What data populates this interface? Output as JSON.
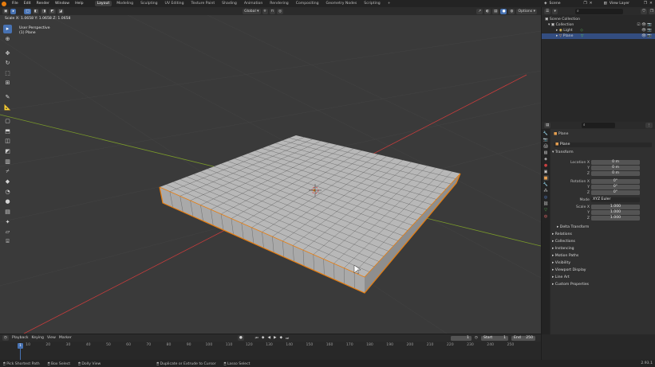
{
  "menubar": {
    "menus": [
      "File",
      "Edit",
      "Render",
      "Window",
      "Help"
    ],
    "workspaces": [
      "Layout",
      "Modeling",
      "Sculpting",
      "UV Editing",
      "Texture Paint",
      "Shading",
      "Animation",
      "Rendering",
      "Compositing",
      "Geometry Nodes",
      "Scripting"
    ],
    "active_workspace": "Layout",
    "add_tab": "+",
    "scene_label": "Scene",
    "view_layer_label": "View Layer"
  },
  "viewport": {
    "orientation_label": "Global",
    "options_label": "Options",
    "operator_info": "Scale X: 1.0658   Y: 1.0658   Z: 1.0658",
    "view_name": "User Perspective",
    "object_name": "(1) Plane"
  },
  "outliner": {
    "root": "Scene Collection",
    "items": [
      "Collection",
      "Light",
      "Plane"
    ]
  },
  "properties": {
    "search_placeholder": "",
    "object_header": "Plane",
    "object_name_field": "Plane",
    "transform_label": "Transform",
    "location_label": "Location X",
    "location": [
      "0 m",
      "0 m",
      "0 m"
    ],
    "rotation_label": "Rotation X",
    "rotation": [
      "0°",
      "0°",
      "0°"
    ],
    "mode_label": "Mode",
    "mode_value": "XYZ Euler",
    "scale_label": "Scale X",
    "scale": [
      "1.000",
      "1.000",
      "1.000"
    ],
    "axis_y": "Y",
    "axis_z": "Z",
    "sections": [
      "Delta Transform",
      "Relations",
      "Collections",
      "Instancing",
      "Motion Paths",
      "Visibility",
      "Viewport Display",
      "Line Art",
      "Custom Properties"
    ]
  },
  "timeline": {
    "menus": [
      "Playback",
      "Keying",
      "View",
      "Marker"
    ],
    "current_frame": "1",
    "start_label": "Start",
    "start_value": "1",
    "end_label": "End",
    "end_value": "250",
    "ticks": [
      "1",
      "10",
      "20",
      "30",
      "40",
      "50",
      "60",
      "70",
      "80",
      "90",
      "100",
      "110",
      "120",
      "130",
      "140",
      "150",
      "160",
      "170",
      "180",
      "190",
      "200",
      "210",
      "220",
      "230",
      "240",
      "250"
    ]
  },
  "statusbar": {
    "items": [
      "Pick Shortest Path",
      "Box Select",
      "Dolly View",
      "Duplicate or Extrude to Cursor",
      "Lasso Select"
    ],
    "version": "2.93.1"
  },
  "colors": {
    "accent": "#4772b3",
    "selection": "#e87d0d",
    "x_axis": "#c83c3c",
    "y_axis": "#7a9a2a"
  }
}
